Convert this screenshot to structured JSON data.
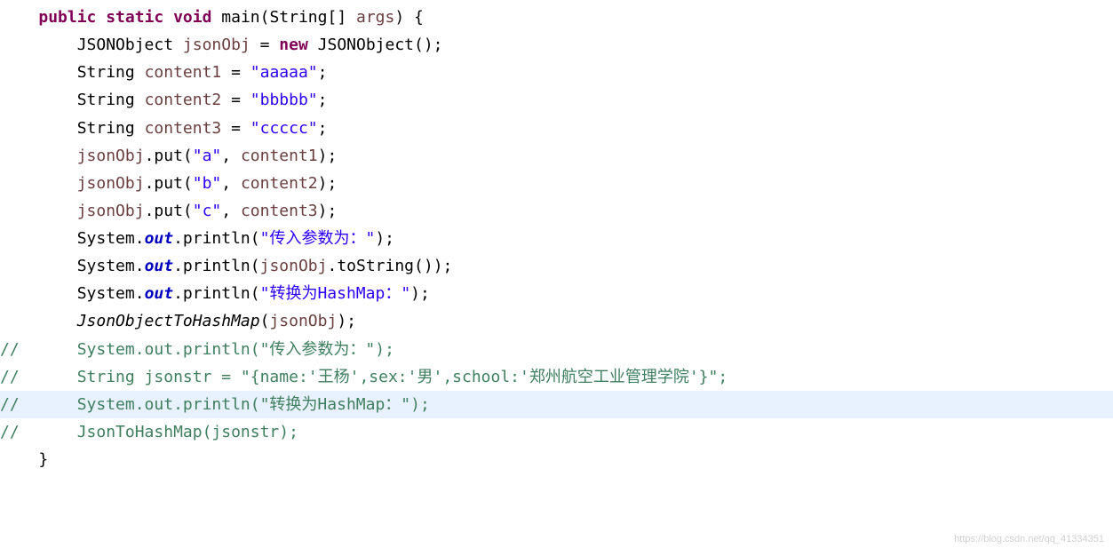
{
  "code": {
    "l1": {
      "indent": "    ",
      "pub": "public ",
      "stat": "static ",
      "void": "void ",
      "main": "main",
      "a": "(String[] ",
      "args": "args",
      "b": ") {"
    },
    "l2": {
      "pre": "        JSONObject ",
      "v": "jsonObj",
      "eq": " = ",
      "new": "new ",
      "post": "JSONObject();"
    },
    "l3": {
      "pre": "        String ",
      "v": "content1",
      "eq": " = ",
      "s": "\"aaaaa\"",
      "end": ";"
    },
    "l4": {
      "pre": "        String ",
      "v": "content2",
      "eq": " = ",
      "s": "\"bbbbb\"",
      "end": ";"
    },
    "l5": {
      "pre": "        String ",
      "v": "content3",
      "eq": " = ",
      "s": "\"ccccc\"",
      "end": ";"
    },
    "l6": {
      "pre": "        ",
      "v": "jsonObj",
      "m": ".put(",
      "s": "\"a\"",
      "c": ", ",
      "v2": "content1",
      "end": ");"
    },
    "l7": {
      "pre": "        ",
      "v": "jsonObj",
      "m": ".put(",
      "s": "\"b\"",
      "c": ", ",
      "v2": "content2",
      "end": ");"
    },
    "l8": {
      "pre": "        ",
      "v": "jsonObj",
      "m": ".put(",
      "s": "\"c\"",
      "c": ", ",
      "v2": "content3",
      "end": ");"
    },
    "l9": {
      "pre": "        System.",
      "out": "out",
      "m": ".println(",
      "s": "\"传入参数为：\"",
      "end": ");"
    },
    "l10": {
      "pre": "        System.",
      "out": "out",
      "m": ".println(",
      "v": "jsonObj",
      "call": ".toString());"
    },
    "l11": {
      "pre": "        System.",
      "out": "out",
      "m": ".println(",
      "s": "\"转换为HashMap：\"",
      "end": ");"
    },
    "l12": {
      "pre": "        ",
      "fn": "JsonObjectToHashMap",
      "a": "(",
      "v": "jsonObj",
      "end": ");"
    },
    "l13": "",
    "l14": "//      System.out.println(\"传入参数为：\");",
    "l15": "//      String jsonstr = \"{name:'王杨',sex:'男',school:'郑州航空工业管理学院'}\";",
    "l16": "//      System.out.println(\"转换为HashMap：\");",
    "l17": "//      JsonToHashMap(jsonstr);",
    "l18": "    }"
  },
  "watermark": "https://blog.csdn.net/qq_41334351"
}
